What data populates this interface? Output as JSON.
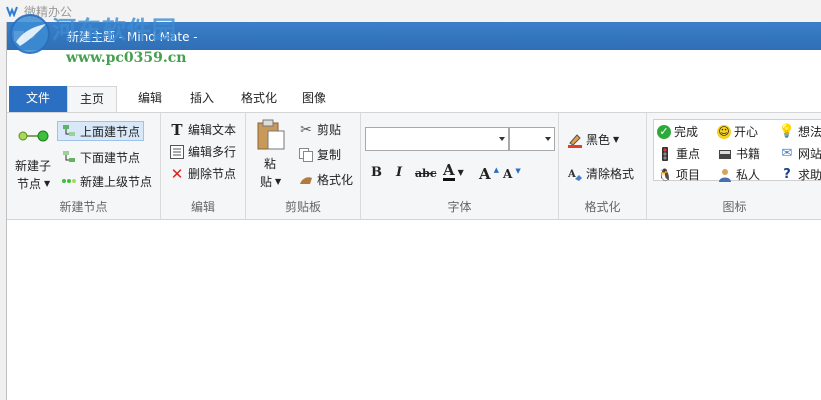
{
  "outer_window": {
    "title": "微精办公"
  },
  "watermark": {
    "line1": "河东软件园",
    "line2": "www.pc0359.cn"
  },
  "titlebar": {
    "title": "新建主题 - Mind Mate -"
  },
  "tabs": [
    {
      "label": "文件"
    },
    {
      "label": "主页"
    },
    {
      "label": "编辑"
    },
    {
      "label": "插入"
    },
    {
      "label": "格式化"
    },
    {
      "label": "图像"
    }
  ],
  "ribbon": {
    "new_node": {
      "label": "新建节点",
      "new_child_line1": "新建子",
      "new_child_line2": "节点",
      "above": "上面建节点",
      "below": "下面建节点",
      "parent": "新建上级节点"
    },
    "edit": {
      "label": "编辑",
      "edit_text": "编辑文本",
      "edit_multiline": "编辑多行",
      "delete_node": "删除节点"
    },
    "clipboard": {
      "label": "剪贴板",
      "paste_line1": "粘",
      "paste_line2": "贴",
      "cut": "剪贴",
      "copy": "复制",
      "format_painter": "格式化"
    },
    "font": {
      "label": "字体",
      "font_name": "",
      "font_size": "",
      "bold": "B",
      "italic": "I",
      "strike": "abc",
      "color": "A",
      "grow": "A",
      "shrink": "A"
    },
    "format": {
      "label": "格式化",
      "color_name": "黑色",
      "clear_format": "清除格式"
    },
    "icons": {
      "label": "图标",
      "items": [
        "完成",
        "开心",
        "想法",
        "重点",
        "书籍",
        "网站",
        "项目",
        "私人",
        "求助"
      ]
    }
  },
  "colors": {
    "accent": "#2a6fc2",
    "titlebar": "#3a7fc8",
    "ribbon_bg": "#f5f6f7"
  }
}
